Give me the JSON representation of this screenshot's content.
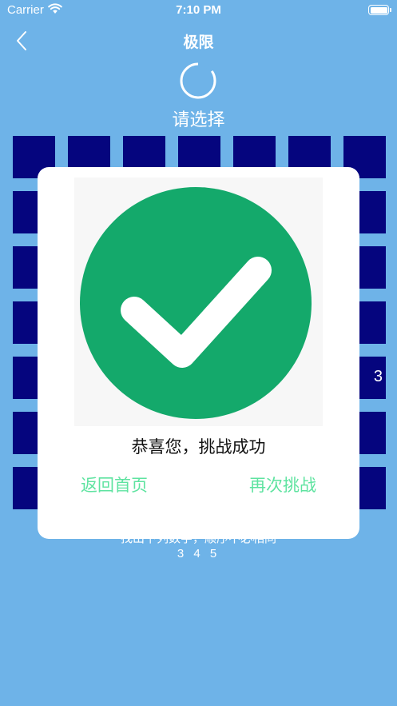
{
  "status_bar": {
    "carrier": "Carrier",
    "time": "7:10 PM"
  },
  "nav": {
    "title": "极限"
  },
  "prompt": "请选择",
  "grid": {
    "rows": 7,
    "cols": 7,
    "visible_number": "3"
  },
  "hint": "找出下列数字，顺序不必相同",
  "sequence": "3 4 5",
  "dialog": {
    "message": "恭喜您，挑战成功",
    "home_button": "返回首页",
    "retry_button": "再次挑战"
  },
  "colors": {
    "background": "#6eb3e8",
    "cell": "#05057e",
    "success": "#14a96b",
    "button_text": "#5ee3a0"
  },
  "icons": {
    "back": "chevron-left-icon",
    "timer": "timer-ring-icon",
    "success": "checkmark-circle-icon"
  }
}
